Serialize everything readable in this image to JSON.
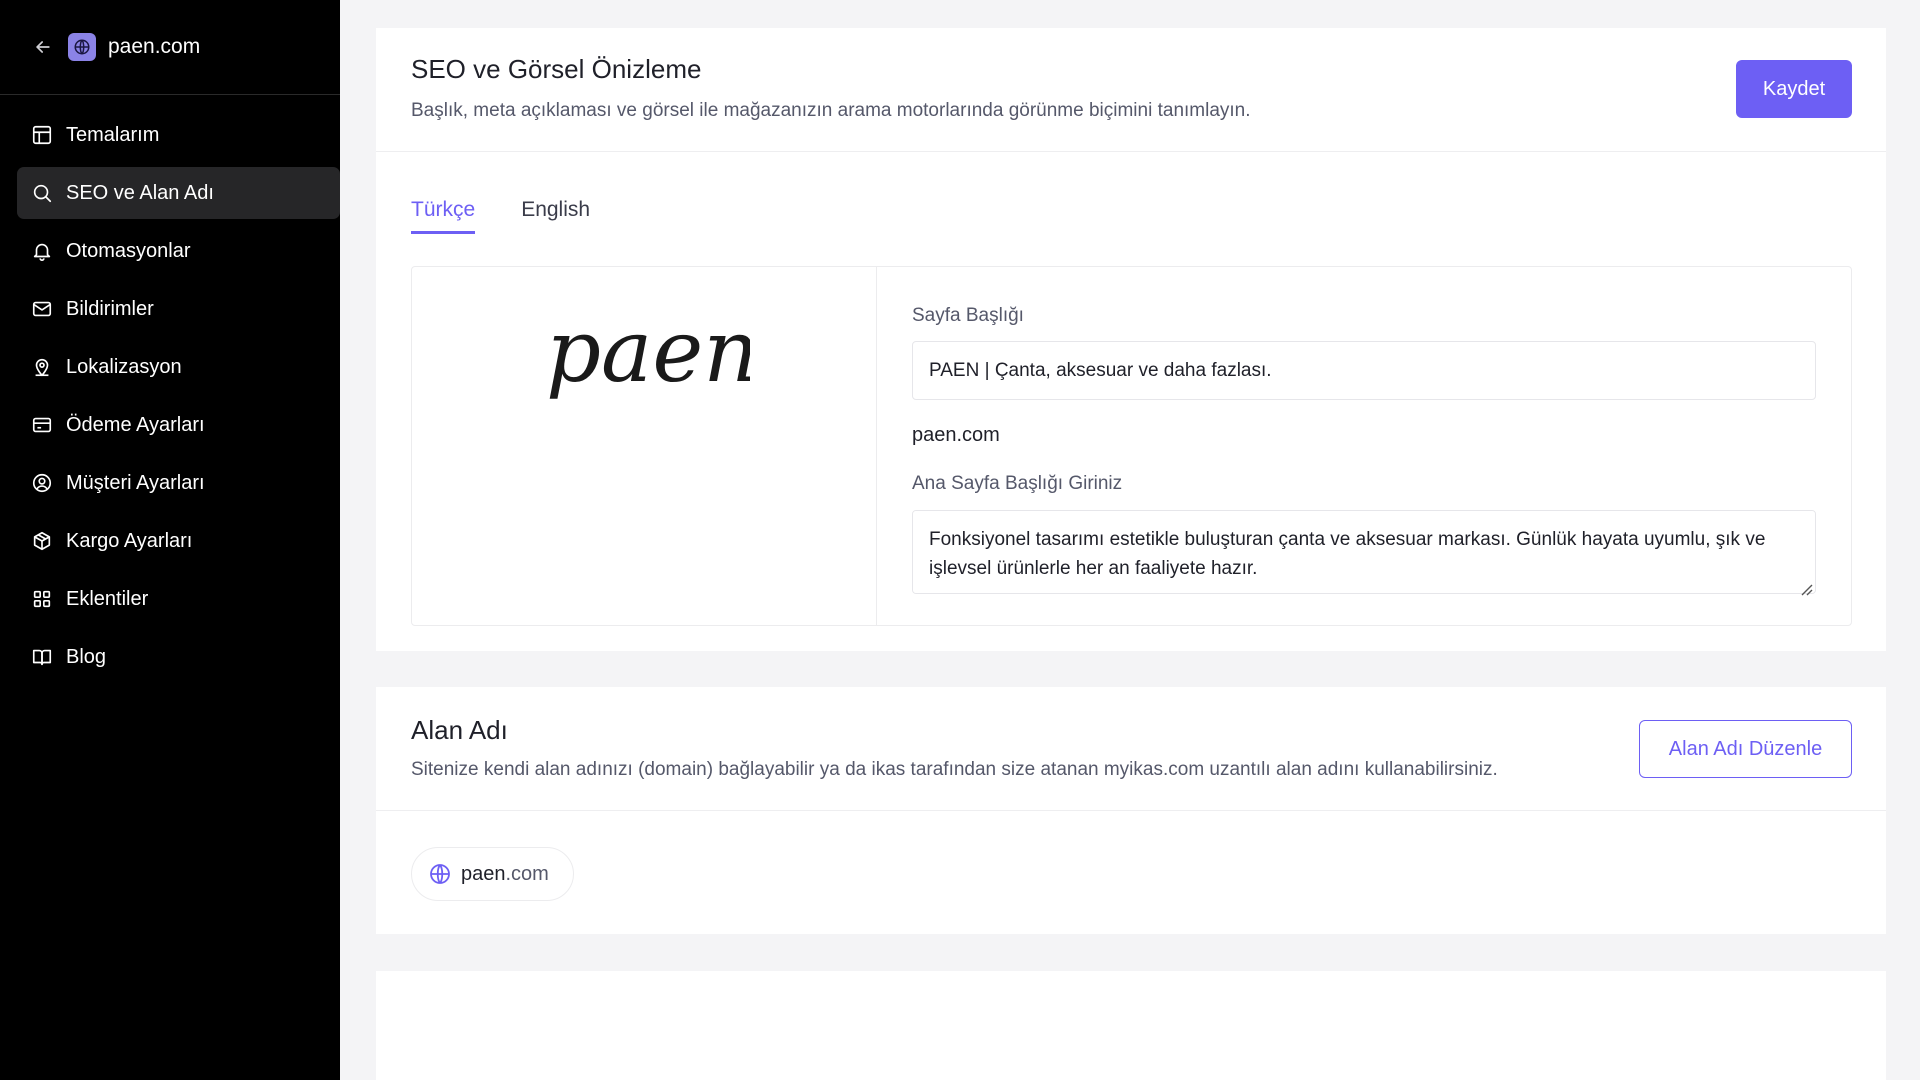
{
  "sidebar": {
    "store_name": "paen.com",
    "items": [
      {
        "label": "Temalarım",
        "icon": "layout-icon",
        "active": false
      },
      {
        "label": "SEO ve Alan Adı",
        "icon": "search-icon",
        "active": true
      },
      {
        "label": "Otomasyonlar",
        "icon": "bell-icon",
        "active": false
      },
      {
        "label": "Bildirimler",
        "icon": "mail-icon",
        "active": false
      },
      {
        "label": "Lokalizasyon",
        "icon": "map-pin-icon",
        "active": false
      },
      {
        "label": "Ödeme Ayarları",
        "icon": "credit-card-icon",
        "active": false
      },
      {
        "label": "Müşteri Ayarları",
        "icon": "user-circle-icon",
        "active": false
      },
      {
        "label": "Kargo Ayarları",
        "icon": "package-icon",
        "active": false
      },
      {
        "label": "Eklentiler",
        "icon": "grid-icon",
        "active": false
      },
      {
        "label": "Blog",
        "icon": "book-open-icon",
        "active": false
      }
    ]
  },
  "seo": {
    "title": "SEO ve Görsel Önizleme",
    "subtitle": "Başlık, meta açıklaması ve görsel ile mağazanızın arama motorlarında görünme biçimini tanımlayın.",
    "save_label": "Kaydet",
    "tabs": [
      {
        "label": "Türkçe",
        "active": true
      },
      {
        "label": "English",
        "active": false
      }
    ],
    "brand_logo_text": "paen",
    "page_title_label": "Sayfa Başlığı",
    "page_title_value": "PAEN | Çanta, aksesuar ve daha fazlası.",
    "domain": "paen.com",
    "home_title_label": "Ana Sayfa Başlığı Giriniz",
    "home_title_value": "Fonksiyonel tasarımı estetikle buluşturan çanta ve aksesuar markası. Günlük hayata uyumlu, şık ve işlevsel ürünlerle her an faaliyete hazır."
  },
  "domain_section": {
    "title": "Alan Adı",
    "subtitle": "Sitenize kendi alan adınızı (domain) bağlayabilir ya da ikas tarafından size atanan myikas.com uzantılı alan adını kullanabilirsiniz.",
    "edit_label": "Alan Adı Düzenle",
    "chip_name": "paen",
    "chip_tld": ".com"
  },
  "colors": {
    "accent": "#6d5ff4",
    "sidebar_bg": "#000000",
    "sidebar_active": "#262628",
    "page_bg": "#f4f4f6"
  }
}
